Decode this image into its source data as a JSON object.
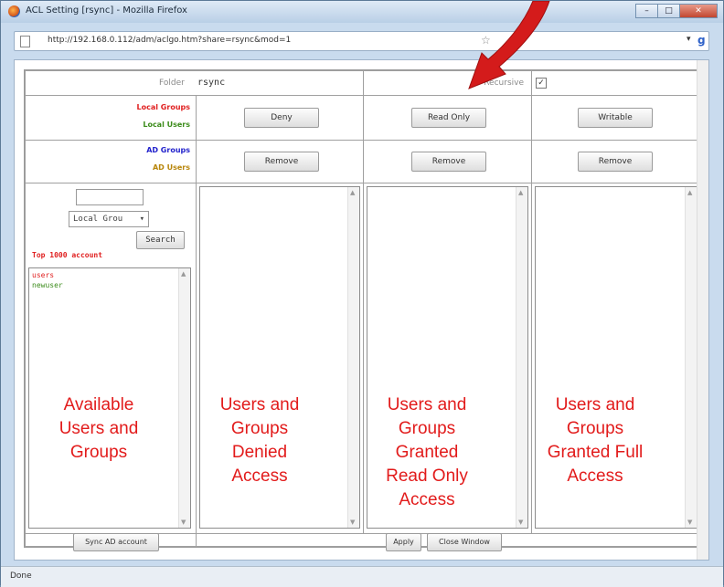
{
  "window": {
    "title": "ACL Setting [rsync] - Mozilla Firefox",
    "url": "http://192.168.0.112/adm/aclgo.htm?share=rsync&mod=1",
    "status": "Done",
    "minimize": "–",
    "maximize": "□",
    "close": "✕"
  },
  "form": {
    "folder_label": "Folder",
    "folder_value": "rsync",
    "recursive_label": "Recursive",
    "recursive_checked": true,
    "row_labels": [
      "Local Groups",
      "Local Users",
      "AD Groups",
      "AD Users"
    ],
    "row_label_colors": [
      "#e02020",
      "#3c8c1c",
      "#2222cc",
      "#b8860b"
    ],
    "deny_button": "Deny",
    "read_only_button": "Read Only",
    "writable_button": "Writable",
    "remove_button": "Remove",
    "search_placeholder": "",
    "search_type": "Local Grou",
    "search_button": "Search",
    "top_account_note": "Top 1000 account",
    "available_items": [
      {
        "name": "users",
        "color": "#e02020"
      },
      {
        "name": "newuser",
        "color": "#3c8c1c"
      }
    ],
    "sync_button": "Sync AD account",
    "apply_button": "Apply",
    "close_window_button": "Close Window"
  },
  "annotations": {
    "available": [
      "Available",
      "Users and",
      "Groups"
    ],
    "denied": [
      "Users and",
      "Groups",
      "Denied",
      "Access"
    ],
    "read_only": [
      "Users and",
      "Groups",
      "Granted",
      "Read Only",
      "Access"
    ],
    "full": [
      "Users and",
      "Groups",
      "Granted Full",
      "Access"
    ],
    "arrow_color": "#d41b1b"
  }
}
